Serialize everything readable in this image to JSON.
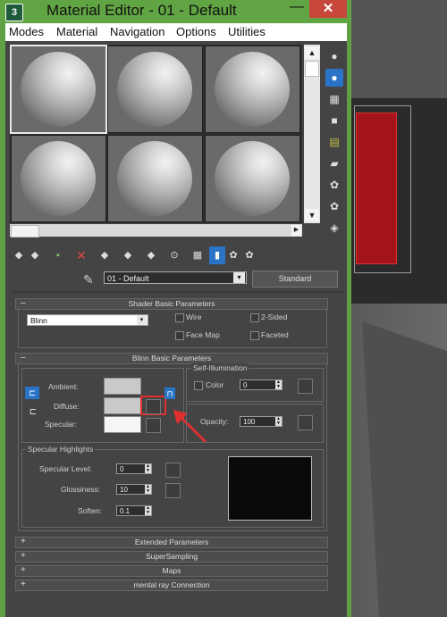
{
  "window": {
    "title": "Material Editor - 01 - Default",
    "app_icon": "3ds-max-icon",
    "minimize_glyph": "—",
    "close_glyph": "✕"
  },
  "menu": [
    "Modes",
    "Material",
    "Navigation",
    "Options",
    "Utilities"
  ],
  "toolbar": {
    "material_name": "01 - Default",
    "material_type": "Standard",
    "dropdown_arrow": "▾"
  },
  "shader_basic": {
    "title": "Shader Basic Parameters",
    "collapse_sign": "–",
    "shader": "Blinn",
    "wire": "Wire",
    "two_sided": "2-Sided",
    "face_map": "Face Map",
    "faceted": "Faceted"
  },
  "blinn_basic": {
    "title": "Blinn Basic Parameters",
    "collapse_sign": "–",
    "ambient": "Ambient:",
    "diffuse": "Diffuse:",
    "specular": "Specular:",
    "self_illum": "Self-Illumination",
    "color": "Color",
    "color_value": "0",
    "opacity": "Opacity:",
    "opacity_value": "100"
  },
  "specular_highlights": {
    "title": "Specular Highlights",
    "specular_level": "Specular Level:",
    "specular_level_value": "0",
    "glossiness": "Glossiness:",
    "glossiness_value": "10",
    "soften": "Soften:",
    "soften_value": "0.1"
  },
  "rollouts": [
    {
      "sign": "+",
      "label": "Extended Parameters"
    },
    {
      "sign": "+",
      "label": "SuperSampling"
    },
    {
      "sign": "+",
      "label": "Maps"
    },
    {
      "sign": "+",
      "label": "mental ray Connection"
    }
  ],
  "colors": {
    "title_bar": "#61a443",
    "accent": "#2a74c8",
    "highlight_annotation": "#e03030"
  }
}
